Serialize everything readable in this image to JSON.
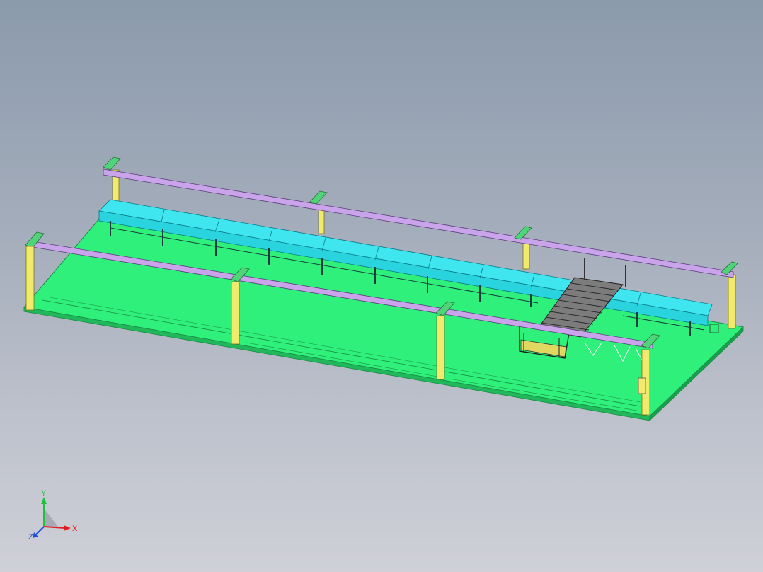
{
  "viewport": {
    "background_top": "#8b9aac",
    "background_bottom": "#cfd0d8"
  },
  "colors": {
    "floor": "#2ff07a",
    "floor_edge": "#1a8a45",
    "conveyor": "#3fe6f0",
    "conveyor_edge": "#0a7a86",
    "rail": "#c9a4ea",
    "rail_edge": "#5a3f7a",
    "post": "#f2ea6a",
    "post_edge": "#7a7420",
    "bracket": "#4fd47a",
    "grating": "#7c7c7c",
    "grating_dark": "#303030",
    "basket": "#e0d860",
    "axis_x": "#e02020",
    "axis_y": "#20c040",
    "axis_z": "#2050e0"
  },
  "triad": {
    "x_label": "X",
    "y_label": "Y",
    "z_label": "Z"
  }
}
